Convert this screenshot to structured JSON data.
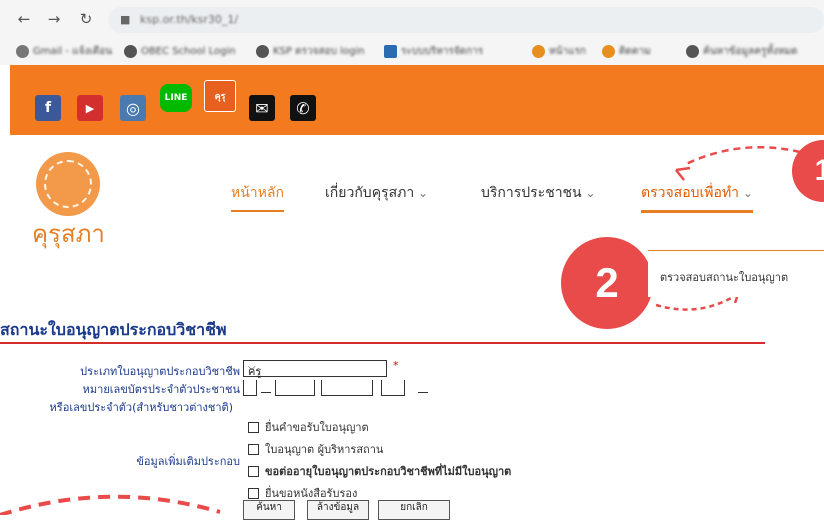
{
  "browser": {
    "url": "ksp.or.th/ksr30_1/",
    "bookmarks": [
      {
        "label": "Gmail - แจ้งเตือน",
        "color": "#777777"
      },
      {
        "label": "OBEC School Login",
        "color": "#555555"
      },
      {
        "label": "KSP ตรวจสอบ login",
        "color": "#555555"
      },
      {
        "label": "ระบบบริหารจัดการ",
        "color": "#2b6cb0"
      },
      {
        "label": "หน้าแรก",
        "color": "#e8901f"
      },
      {
        "label": "ติดตาม",
        "color": "#e8901f"
      },
      {
        "label": "ค้นหาข้อมูลครูทั้งหมด",
        "color": "#555555"
      }
    ]
  },
  "social": [
    {
      "name": "facebook-icon",
      "glyph": "f",
      "color": "#3b5998"
    },
    {
      "name": "youtube-icon",
      "glyph": "▶",
      "color": "#d32f2f"
    },
    {
      "name": "instagram-icon",
      "glyph": "◎",
      "color": "#4a7ab0"
    },
    {
      "name": "line-icon",
      "glyph": "LINE",
      "color": "#00b900"
    },
    {
      "name": "ksp-app-icon",
      "glyph": "คุรุ",
      "color": "#e8601f"
    },
    {
      "name": "mail-icon",
      "glyph": "✉",
      "color": "#111111"
    },
    {
      "name": "phone-icon",
      "glyph": "✆",
      "color": "#111111"
    }
  ],
  "logo": {
    "text": "คุรุสภา"
  },
  "menu": {
    "home": "หน้าหลัก",
    "about": "เกี่ยวกับคุรุสภา",
    "services": "บริการประชาชน",
    "check": "ตรวจสอบเพื่อทำ"
  },
  "annotations": {
    "step1": "1",
    "step2": "2"
  },
  "submenu": {
    "item": "ตรวจสอบสถานะใบอนุญาต"
  },
  "form": {
    "title": "สถานะใบอนุญาตประกอบวิชาชีพ",
    "type_label": "ประเภทใบอนุญาตประกอบวิชาชีพ",
    "type_value": "ครู",
    "id_label": "หมายเลขบัตรประจำตัวประชาชน",
    "passport_label": "หรือเลขประจำตัว(สำหรับชาวต่างชาติ)",
    "status_label": "ข้อมูลเพิ่มเติมประกอบ",
    "options": [
      "ยื่นคำขอรับใบอนุญาต",
      "ใบอนุญาต ผู้บริหารสถาน",
      "ขอต่ออายุใบอนุญาตประกอบวิชาชีพที่ไม่มีใบอนุญาต",
      "ยื่นขอหนังสือรับรอง"
    ],
    "buttons": [
      "ค้นหา",
      "ล้างข้อมูล",
      "ยกเลิก"
    ]
  }
}
